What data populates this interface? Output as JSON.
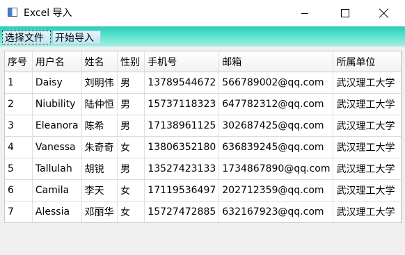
{
  "window": {
    "title": "Excel 导入",
    "controls": {
      "minimize": "minimize",
      "maximize": "maximize",
      "close": "close"
    }
  },
  "toolbar": {
    "choose_file_label": "选择文件",
    "start_import_label": "开始导入"
  },
  "colors": {
    "toolbar_accent": "#2fc9b7",
    "button_bg": "#cfeef7"
  },
  "table": {
    "columns": [
      "序号",
      "用户名",
      "姓名",
      "性别",
      "手机号",
      "邮箱",
      "所属单位"
    ],
    "rows": [
      [
        "1",
        "Daisy",
        "刘明伟",
        "男",
        "13789544672",
        "566789002@qq.com",
        "武汉理工大学"
      ],
      [
        "2",
        "Niubility",
        "陆仲恒",
        "男",
        "15737118323",
        "647782312@qq.com",
        "武汉理工大学"
      ],
      [
        "3",
        "Eleanora",
        "陈希",
        "男",
        "17138961125",
        "302687425@qq.com",
        "武汉理工大学"
      ],
      [
        "4",
        "Vanessa",
        "朱奇奇",
        "女",
        "13806352180",
        "636839245@qq.com",
        "武汉理工大学"
      ],
      [
        "5",
        "Tallulah",
        "胡锐",
        "男",
        "13527423133",
        "1734867890@qq.com",
        "武汉理工大学"
      ],
      [
        "6",
        "Camila",
        "李天",
        "女",
        "17119536497",
        "202712359@qq.com",
        "武汉理工大学"
      ],
      [
        "7",
        "Alessia",
        "邓丽华",
        "女",
        "15727472885",
        "632167923@qq.com",
        "武汉理工大学"
      ]
    ]
  }
}
